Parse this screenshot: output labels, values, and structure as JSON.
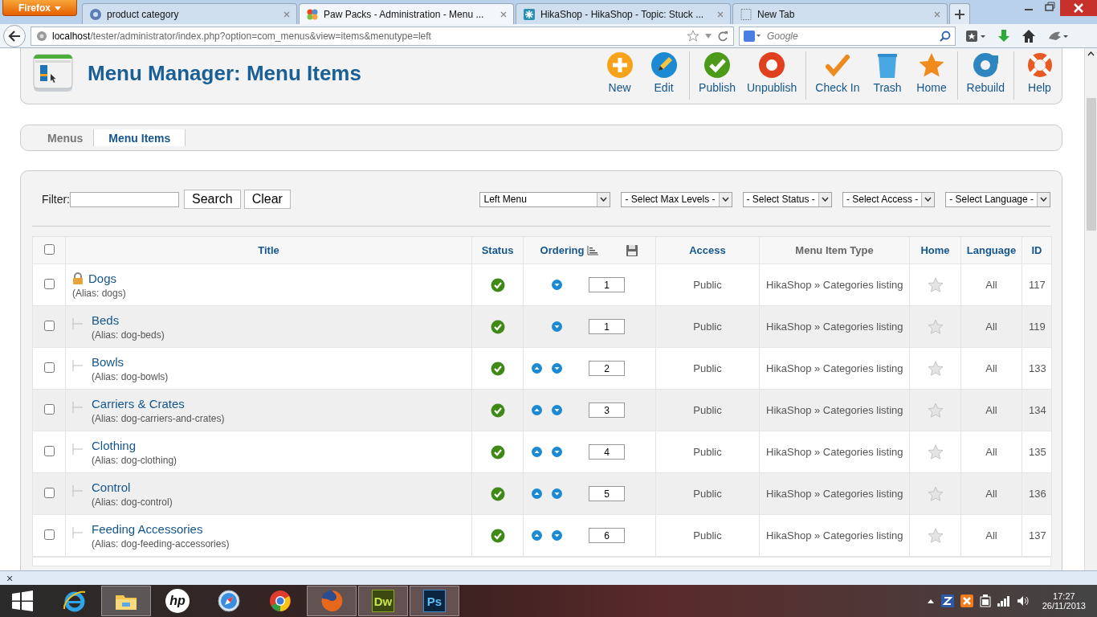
{
  "browser": {
    "app_button": "Firefox",
    "tabs": [
      {
        "label": "product category",
        "selected": false
      },
      {
        "label": "Paw Packs - Administration - Menu ...",
        "selected": true
      },
      {
        "label": "HikaShop - HikaShop - Topic: Stuck ...",
        "selected": false
      },
      {
        "label": "New Tab",
        "selected": false
      }
    ],
    "url_host": "localhost",
    "url_path": "/tester/administrator/index.php?option=com_menus&view=items&menutype=left",
    "search_placeholder": "Google"
  },
  "page": {
    "title": "Menu Manager: Menu Items",
    "toolbar_groups": [
      {
        "buttons": [
          "New",
          "Edit"
        ]
      },
      {
        "buttons": [
          "Publish",
          "Unpublish"
        ]
      },
      {
        "buttons": [
          "Check In",
          "Trash",
          "Home"
        ]
      },
      {
        "buttons": [
          "Rebuild"
        ]
      },
      {
        "buttons": [
          "Help"
        ]
      }
    ],
    "submenu": [
      {
        "label": "Menus",
        "selected": false
      },
      {
        "label": "Menu Items",
        "selected": true
      }
    ],
    "filter": {
      "label": "Filter:",
      "search_button": "Search",
      "clear_button": "Clear",
      "selects": [
        "Left Menu",
        "- Select Max Levels -",
        "- Select Status -",
        "- Select Access -",
        "- Select Language -"
      ]
    },
    "table": {
      "select_all_checked": false,
      "columns": [
        {
          "label": "Title",
          "sortable": true
        },
        {
          "label": "Status",
          "sortable": true
        },
        {
          "label": "Ordering",
          "sortable": true
        },
        {
          "label": "Access",
          "sortable": true
        },
        {
          "label": "Menu Item Type",
          "sortable": false
        },
        {
          "label": "Home",
          "sortable": true
        },
        {
          "label": "Language",
          "sortable": true
        },
        {
          "label": "ID",
          "sortable": true
        }
      ],
      "rows": [
        {
          "title": "Dogs",
          "alias": "(Alias: dogs)",
          "locked": true,
          "checked": false,
          "published": true,
          "up": false,
          "down": true,
          "order": "1",
          "access": "Public",
          "type": "HikaShop » Categories listing",
          "home": false,
          "language": "All",
          "id": "117",
          "children": [
            {
              "title": "Beds",
              "alias": "(Alias: dog-beds)",
              "locked": false,
              "checked": false,
              "published": true,
              "up": false,
              "down": true,
              "order": "1",
              "access": "Public",
              "type": "HikaShop » Categories listing",
              "home": false,
              "language": "All",
              "id": "119"
            },
            {
              "title": "Bowls",
              "alias": "(Alias: dog-bowls)",
              "locked": false,
              "checked": false,
              "published": true,
              "up": true,
              "down": true,
              "order": "2",
              "access": "Public",
              "type": "HikaShop » Categories listing",
              "home": false,
              "language": "All",
              "id": "133"
            },
            {
              "title": "Carriers & Crates",
              "alias": "(Alias: dog-carriers-and-crates)",
              "locked": false,
              "checked": false,
              "published": true,
              "up": true,
              "down": true,
              "order": "3",
              "access": "Public",
              "type": "HikaShop » Categories listing",
              "home": false,
              "language": "All",
              "id": "134"
            },
            {
              "title": "Clothing",
              "alias": "(Alias: dog-clothing)",
              "locked": false,
              "checked": false,
              "published": true,
              "up": true,
              "down": true,
              "order": "4",
              "access": "Public",
              "type": "HikaShop » Categories listing",
              "home": false,
              "language": "All",
              "id": "135"
            },
            {
              "title": "Control",
              "alias": "(Alias: dog-control)",
              "locked": false,
              "checked": false,
              "published": true,
              "up": true,
              "down": true,
              "order": "5",
              "access": "Public",
              "type": "HikaShop » Categories listing",
              "home": false,
              "language": "All",
              "id": "136"
            },
            {
              "title": "Feeding Accessories",
              "alias": "(Alias: dog-feeding-accessories)",
              "locked": false,
              "checked": false,
              "published": true,
              "up": true,
              "down": true,
              "order": "6",
              "access": "Public",
              "type": "HikaShop » Categories listing",
              "home": false,
              "language": "All",
              "id": "137"
            }
          ]
        }
      ]
    }
  },
  "find_bar": {
    "close": "×"
  },
  "taskbar": {
    "apps": [
      {
        "active": false
      },
      {
        "active": true
      },
      {
        "label": "hp",
        "active": false
      },
      {
        "active": false
      },
      {
        "active": false
      },
      {
        "active": true
      },
      {
        "label": "Dw",
        "active": true
      },
      {
        "label": "Ps",
        "active": true
      }
    ],
    "time": "17:27",
    "date": "26/11/2013"
  }
}
